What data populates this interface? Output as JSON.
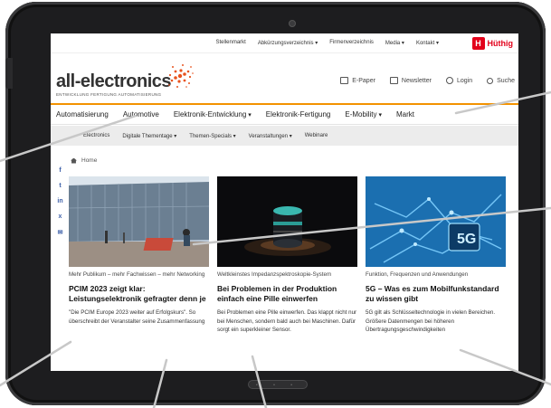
{
  "topbar": {
    "links": [
      "Stellenmarkt",
      "Abkürzungsverzeichnis",
      "Firmenverzeichnis",
      "Media",
      "Kontakt"
    ],
    "publisher": "Hüthig"
  },
  "brand": {
    "logo": "all-electronics",
    "tagline": "ENTWICKLUNG FERTIGUNG AUTOMATISIERUNG",
    "actions": [
      "E-Paper",
      "Newsletter",
      "Login",
      "Suche"
    ]
  },
  "mainnav": [
    "Automatisierung",
    "Automotive",
    "Elektronik-Entwicklung",
    "Elektronik-Fertigung",
    "E-Mobility",
    "Markt"
  ],
  "subnav": [
    "Electronics",
    "Digitale Thementage",
    "Themen-Specials",
    "Veranstaltungen",
    "Webinare"
  ],
  "breadcrumb": "Home",
  "social": [
    "f",
    "t",
    "in",
    "x",
    "✉"
  ],
  "articles": [
    {
      "kicker": "Mehr Publikum – mehr Fachwissen – mehr Networking",
      "headline": "PCIM 2023 zeigt klar: Leistungselektronik gefragter denn je",
      "teaser": "\"Die PCIM Europe 2023 weiter auf Erfolgskurs\". So überschreibt der Veranstalter seine Zusammenfassung"
    },
    {
      "kicker": "Weltkleinstes Impedanzspektroskopie-System",
      "headline": "Bei Problemen in der Produktion einfach eine Pille einwerfen",
      "teaser": "Bei Problemen eine Pille einwerfen. Das klappt nicht nur bei Menschen, sondern bald auch bei Maschinen. Dafür sorgt ein superkleiner Sensor."
    },
    {
      "kicker": "Funktion, Frequenzen und Anwendungen",
      "headline": "5G – Was es zum Mobilfunkstandard zu wissen gibt",
      "teaser": "5G gilt als Schlüsseltechnologie in vielen Bereichen. Größere Datenmengen bei höheren Übertragungsgeschwindigkeiten"
    }
  ],
  "colors": {
    "accent": "#f39200",
    "publisher": "#e2001a",
    "bezel": "#1d1d1f"
  }
}
